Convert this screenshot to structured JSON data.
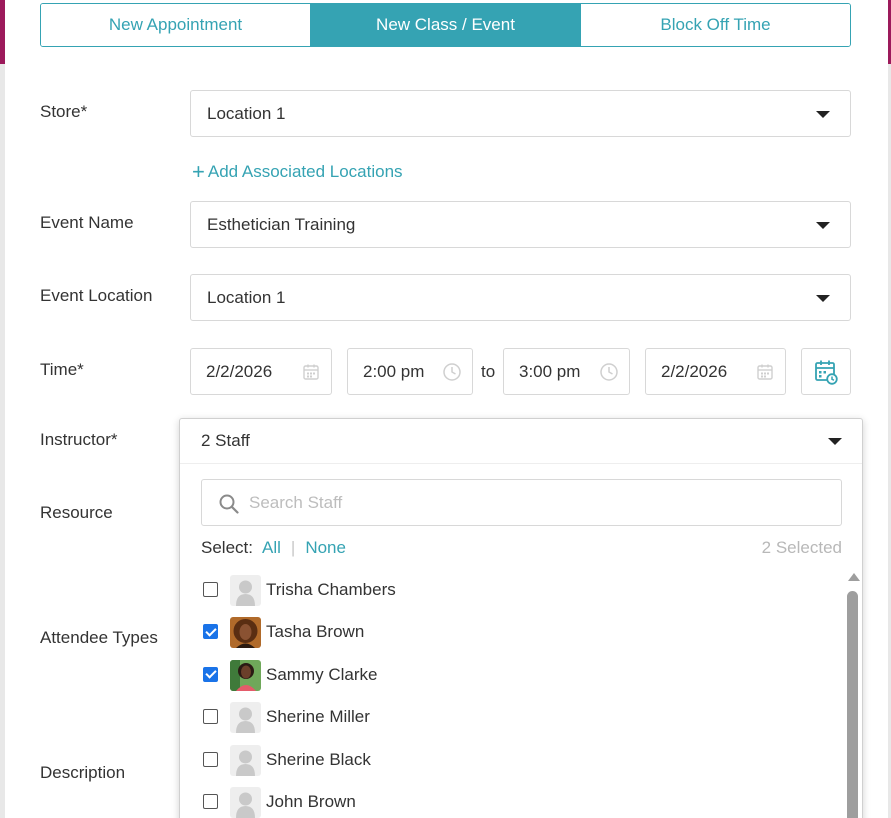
{
  "tabs": [
    {
      "label": "New Appointment"
    },
    {
      "label": "New Class / Event"
    },
    {
      "label": "Block Off Time"
    }
  ],
  "colors": {
    "accent": "#35a3b3",
    "checkbox": "#1a73e8",
    "brand": "#9c1a5b"
  },
  "form": {
    "store_label": "Store*",
    "store_value": "Location 1",
    "add_locations": "Add Associated Locations",
    "event_name_label": "Event Name",
    "event_name_value": "Esthetician Training",
    "event_location_label": "Event Location",
    "event_location_value": "Location 1",
    "time_label": "Time*",
    "start_date": "2/2/2026",
    "start_time": "2:00 pm",
    "to_text": "to",
    "end_time": "3:00 pm",
    "end_date": "2/2/2026",
    "instructor_label": "Instructor*",
    "resource_label": "Resource",
    "attendee_types_label": "Attendee Types",
    "description_label": "Description"
  },
  "instructor_dropdown": {
    "value": "2 Staff",
    "search_placeholder": "Search Staff",
    "select_label": "Select:",
    "all_label": "All",
    "divider": "|",
    "none_label": "None",
    "selected_count": "2 Selected",
    "staff": [
      {
        "name": "Trisha Chambers",
        "checked": false,
        "avatar": "placeholder"
      },
      {
        "name": "Tasha Brown",
        "checked": true,
        "avatar": "photo"
      },
      {
        "name": "Sammy Clarke",
        "checked": true,
        "avatar": "photo"
      },
      {
        "name": "Sherine Miller",
        "checked": false,
        "avatar": "placeholder"
      },
      {
        "name": "Sherine Black",
        "checked": false,
        "avatar": "placeholder"
      },
      {
        "name": "John Brown",
        "checked": false,
        "avatar": "placeholder"
      }
    ]
  }
}
